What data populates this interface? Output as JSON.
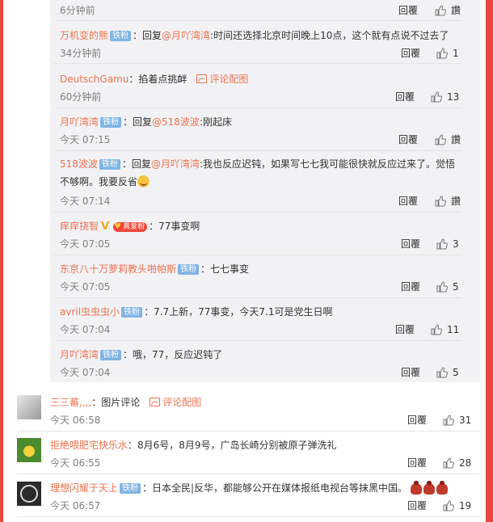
{
  "colors": {
    "frame": "#e8473c",
    "link": "#eb7350",
    "badge": "#7fb4e3",
    "time": "#808080"
  },
  "reply_label": "回覆",
  "like_label": "讚",
  "pic_comment_label": "评论配图",
  "top_partial": {
    "time": "6分钟前",
    "like": "讚"
  },
  "replies": [
    {
      "user": "万机变的熊",
      "badge": "铁粉",
      "prefix": "：回复",
      "mention": "@月吖湾湾",
      "text": ":时间还选择北京时间晚上10点，这个就有点说不过去了",
      "time": "34分钟前",
      "like": "1"
    },
    {
      "user": "DeutschGamu",
      "text": "：掐着点挑衅",
      "pic": true,
      "time": "60分钟前",
      "like": "13"
    },
    {
      "user": "月吖湾湾",
      "badge": "铁粉",
      "prefix": "：回复",
      "mention": "@518波波",
      "text": ":刚起床",
      "time": "今天 07:15",
      "like": "讚"
    },
    {
      "user": "518波波",
      "badge": "铁粉",
      "prefix": "：回复",
      "mention": "@月吖湾湾",
      "text": ":我也反应迟钝，如果写七七我可能很快就反应过来了。觉悟",
      "text2": "不够啊。我要反省",
      "time": "今天 07:14",
      "like": "讚"
    },
    {
      "user": "痒痒挠智",
      "vip": "V",
      "fan": "真爱粉",
      "text": "：77事变啊",
      "time": "今天 07:05",
      "like": "3"
    },
    {
      "user": "东京八十万萝莉教头啪帕斯",
      "badge": "铁粉",
      "text": "：七七事变",
      "time": "今天 07:05",
      "like": "5"
    },
    {
      "user": "avril虫虫虫小",
      "badge": "铁粉",
      "text": "：7.7上新，77事变，今天7.1可是党生日啊",
      "time": "今天 07:04",
      "like": "11"
    },
    {
      "user": "月吖湾湾",
      "badge": "铁粉",
      "text": "：哦，77，反应迟钝了",
      "time": "今天 07:04",
      "like": "5"
    }
  ],
  "comments": [
    {
      "user": "三三蕃,,,,",
      "text": "：图片评论",
      "pic": true,
      "time": "今天 06:58",
      "like": "31"
    },
    {
      "user": "拒绝喂肥宅快乐水",
      "text": "：8月6号，8月9号，广岛长崎分别被原子弹洗礼",
      "time": "今天 06:55",
      "like": "28"
    },
    {
      "user": "理想闪耀于天上",
      "badge": "铁粉",
      "text": "：日本全民|反华，都能够公开在媒体报纸电视台等抹黑中国。",
      "time": "今天 06:57",
      "like": "19"
    }
  ]
}
